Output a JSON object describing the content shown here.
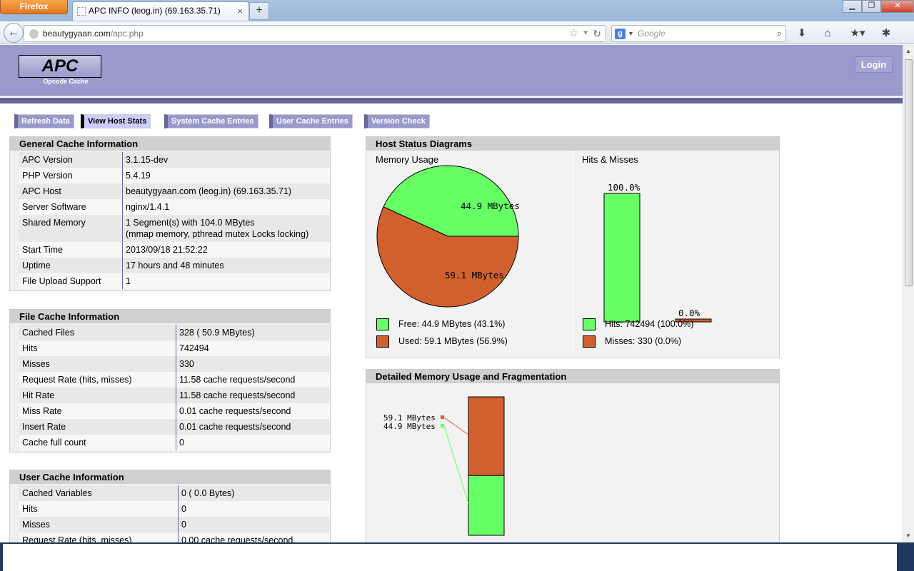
{
  "browser": {
    "app_button": "Firefox",
    "tab_title": "APC INFO (leog.in) (69.163.35.71)",
    "tab_close": "×",
    "new_tab": "+",
    "url_domain": "beautygyaan.com",
    "url_path": "/apc.php",
    "search_placeholder": "Google",
    "search_engine_letter": "g"
  },
  "header": {
    "logo": "APC",
    "logo_sub": "Opcode Cache",
    "login": "Login"
  },
  "menu": [
    {
      "label": "Refresh Data",
      "active": false
    },
    {
      "label": "View Host Stats",
      "active": true
    },
    {
      "label": "System Cache Entries",
      "active": false
    },
    {
      "label": "User Cache Entries",
      "active": false
    },
    {
      "label": "Version Check",
      "active": false
    }
  ],
  "general": {
    "title": "General Cache Information",
    "rows": [
      {
        "k": "APC Version",
        "v": "3.1.15-dev"
      },
      {
        "k": "PHP Version",
        "v": "5.4.19"
      },
      {
        "k": "APC Host",
        "v": "beautygyaan.com (leog.in) (69.163.35.71)"
      },
      {
        "k": "Server Software",
        "v": "nginx/1.4.1"
      },
      {
        "k": "Shared Memory",
        "v": "1 Segment(s) with 104.0 MBytes",
        "v2": "(mmap memory, pthread mutex Locks locking)"
      },
      {
        "k": "Start Time",
        "v": "2013/09/18 21:52:22"
      },
      {
        "k": "Uptime",
        "v": "17 hours and 48 minutes"
      },
      {
        "k": "File Upload Support",
        "v": "1"
      }
    ]
  },
  "file_cache": {
    "title": "File Cache Information",
    "rows": [
      {
        "k": "Cached Files",
        "v": "328 ( 50.9 MBytes)"
      },
      {
        "k": "Hits",
        "v": "742494"
      },
      {
        "k": "Misses",
        "v": "330"
      },
      {
        "k": "Request Rate (hits, misses)",
        "v": "11.58 cache requests/second"
      },
      {
        "k": "Hit Rate",
        "v": "11.58 cache requests/second"
      },
      {
        "k": "Miss Rate",
        "v": "0.01 cache requests/second"
      },
      {
        "k": "Insert Rate",
        "v": "0.01 cache requests/second"
      },
      {
        "k": "Cache full count",
        "v": "0"
      }
    ]
  },
  "user_cache": {
    "title": "User Cache Information",
    "rows": [
      {
        "k": "Cached Variables",
        "v": "0 ( 0.0 Bytes)"
      },
      {
        "k": "Hits",
        "v": "0"
      },
      {
        "k": "Misses",
        "v": "0"
      },
      {
        "k": "Request Rate (hits, misses)",
        "v": "0.00 cache requests/second"
      }
    ]
  },
  "host_status": {
    "title": "Host Status Diagrams",
    "memory_title": "Memory Usage",
    "hits_title": "Hits & Misses",
    "pie_free_label": "44.9 MBytes",
    "pie_used_label": "59.1 MBytes",
    "bar_hits_label": "100.0%",
    "bar_miss_label": "0.0%",
    "legend_free": "Free: 44.9 MBytes (43.1%)",
    "legend_used": "Used: 59.1 MBytes (56.9%)",
    "legend_hits": "Hits: 742494 (100.0%)",
    "legend_misses": "Misses: 330 (0.0%)"
  },
  "fragmentation": {
    "title": "Detailed Memory Usage and Fragmentation",
    "label_used": "59.1 MBytes",
    "label_free": "44.9 MBytes"
  },
  "colors": {
    "free": "#66ff66",
    "used": "#d2602e",
    "header": "#9999cc",
    "menu_border": "#666699"
  },
  "chart_data": [
    {
      "type": "pie",
      "categories": [
        "Free",
        "Used"
      ],
      "values": [
        44.9,
        59.1
      ],
      "unit": "MBytes",
      "title": "Memory Usage"
    },
    {
      "type": "bar",
      "categories": [
        "Hits",
        "Misses"
      ],
      "values": [
        100.0,
        0.0
      ],
      "unit": "%",
      "title": "Hits & Misses"
    },
    {
      "type": "bar",
      "categories": [
        "Used",
        "Free"
      ],
      "values": [
        59.1,
        44.9
      ],
      "unit": "MBytes",
      "title": "Detailed Memory Usage and Fragmentation"
    }
  ]
}
